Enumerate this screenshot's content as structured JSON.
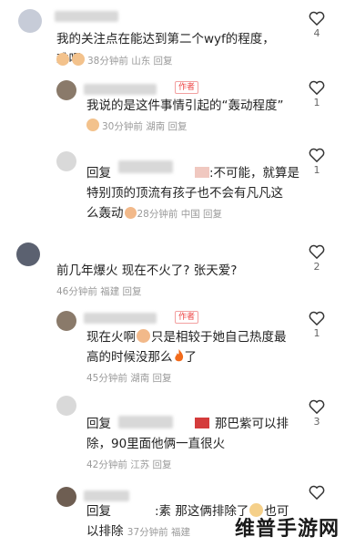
{
  "comments": [
    {
      "text": "我的关注点在能达到第二个wyf的程度，难吧",
      "meta": "38分钟前 山东 回复",
      "likes": "4",
      "author": false
    },
    {
      "text": "我说的是这件事情引起的“轰动程度”",
      "meta": "30分钟前 湖南 回复",
      "likes": "1",
      "author": true
    },
    {
      "reply_prefix": "回复",
      "text_a": ":不可能，就算是",
      "text_b": "特别顶的顶流有孩子也不会有凡凡这",
      "text_c": "么轰动",
      "meta": "28分钟前 中国 回复",
      "likes": "1"
    },
    {
      "text": "前几年爆火 现在不火了? 张天爱?",
      "meta": "46分钟前 福建 回复",
      "likes": "2"
    },
    {
      "text_a": "现在火啊",
      "text_b": "只是相较于她自己热度最",
      "text_c": "高的时候没那么",
      "text_d": "了",
      "meta": "45分钟前 湖南 回复",
      "likes": "1",
      "author": true
    },
    {
      "reply_prefix": "回复",
      "text_a": "那巴紫可以排",
      "text_b": "除，90里面他俩一直很火",
      "meta": "42分钟前 江苏 回复",
      "likes": "3"
    },
    {
      "reply_prefix": "回复",
      "text_a": ":素 那这俩排除了",
      "text_b": "也可",
      "text_c": "以排除",
      "meta": "37分钟前 福建",
      "likes": ""
    }
  ],
  "author_tag_label": "作者",
  "watermark": "维普手游网",
  "colors": {
    "accent": "#e44444",
    "meta": "#9a9a9a"
  }
}
